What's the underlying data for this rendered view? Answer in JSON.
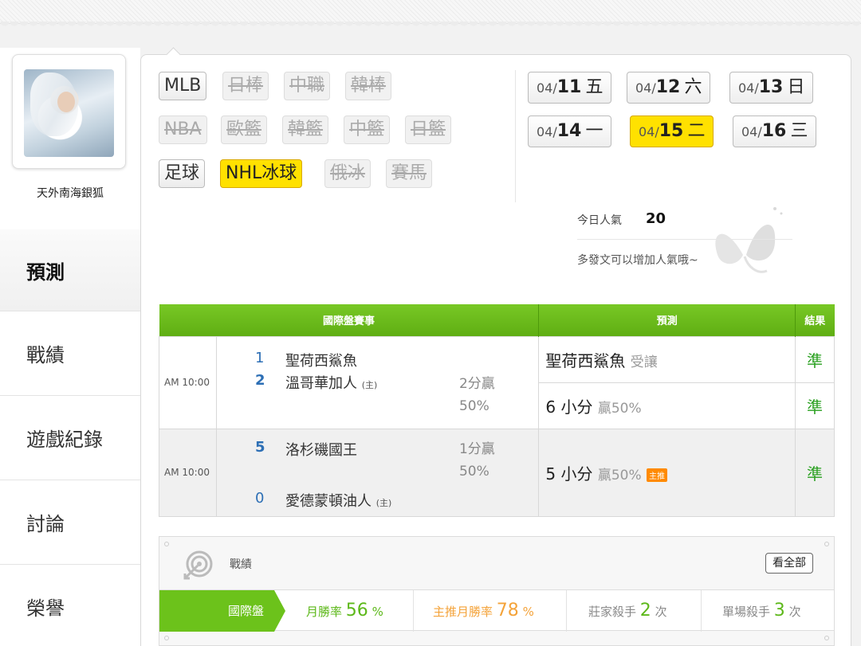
{
  "user": {
    "name": "天外南海銀狐"
  },
  "nav": [
    "預測",
    "戰績",
    "遊戲紀錄",
    "討論",
    "榮譽"
  ],
  "sports": {
    "row1": [
      "MLB",
      "日棒",
      "中職",
      "韓棒"
    ],
    "row2": [
      "NBA",
      "歐籃",
      "韓籃",
      "中籃",
      "日籃"
    ],
    "row3": [
      "足球",
      "NHL冰球",
      "俄冰",
      "賽馬"
    ],
    "active": "NHL冰球"
  },
  "dates": [
    {
      "md": "04/",
      "d": "11",
      "w": "五"
    },
    {
      "md": "04/",
      "d": "12",
      "w": "六"
    },
    {
      "md": "04/",
      "d": "13",
      "w": "日"
    },
    {
      "md": "04/",
      "d": "14",
      "w": "一"
    },
    {
      "md": "04/",
      "d": "15",
      "w": "二",
      "active": true
    },
    {
      "md": "04/",
      "d": "16",
      "w": "三"
    }
  ],
  "popularity": {
    "label": "今日人氣",
    "value": "20",
    "tip": "多發文可以增加人氣哦~"
  },
  "table": {
    "headers": [
      "國際盤賽事",
      "預測",
      "結果"
    ],
    "games": [
      {
        "time": "AM 10:00",
        "away_num": "1",
        "away": "聖荷西鯊魚",
        "home_num": "2",
        "home": "溫哥華加人",
        "host": "(主)",
        "handicap": "2分贏",
        "handicap_pct": "50%",
        "pred1_main": "聖荷西鯊魚",
        "pred1_sub": "受讓",
        "res1": "準",
        "pred2_main": "6 小分",
        "pred2_sub": "贏50%",
        "res2": "準"
      },
      {
        "time": "AM 10:00",
        "away_num": "5",
        "away": "洛杉磯國王",
        "home_num": "0",
        "home": "愛德蒙頓油人",
        "host": "(主)",
        "handicap": "1分贏",
        "handicap_pct": "50%",
        "pred_main": "5 小分",
        "pred_sub": "贏50%",
        "badge": "主推",
        "res": "準"
      }
    ]
  },
  "record": {
    "title": "戰績",
    "view_all": "看全部",
    "tab": "國際盤",
    "month_rate_label": "月勝率",
    "month_rate": "56",
    "month_rate_unit": "%",
    "main_rate_label": "主推月勝率",
    "main_rate": "78",
    "main_rate_unit": "%",
    "banker_label": "莊家殺手",
    "banker": "2",
    "banker_unit": "次",
    "single_label": "單場殺手",
    "single": "3",
    "single_unit": "次"
  },
  "colors": {
    "green": "#6cc21b",
    "yellow": "#ffe100",
    "orange": "#f4a33a",
    "blue": "#2d6fb5"
  }
}
